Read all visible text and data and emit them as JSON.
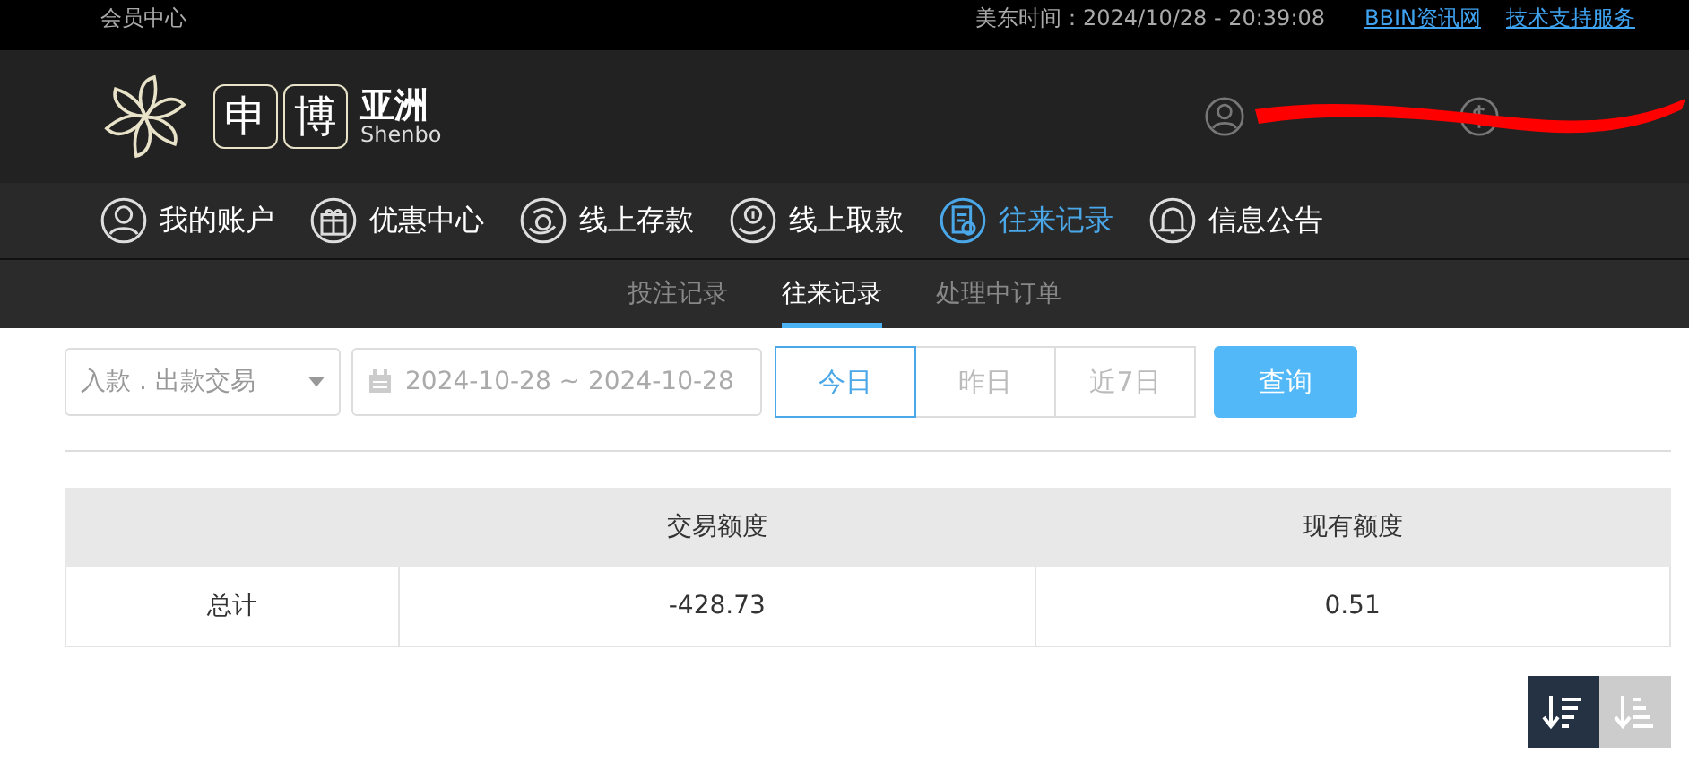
{
  "topbar": {
    "title": "会员中心",
    "time": "美东时间：2024/10/28 - 20:39:08",
    "links": [
      "BBIN资讯网",
      "技术支持服务"
    ]
  },
  "logo": {
    "chars": [
      "申",
      "博"
    ],
    "cn": "亚洲",
    "en": "Shenbo"
  },
  "nav": [
    {
      "label": "我的账户",
      "kind": "user",
      "selected": false
    },
    {
      "label": "优惠中心",
      "kind": "gift",
      "selected": false
    },
    {
      "label": "线上存款",
      "kind": "deposit",
      "selected": false
    },
    {
      "label": "线上取款",
      "kind": "withdraw",
      "selected": false
    },
    {
      "label": "往来记录",
      "kind": "record",
      "selected": true
    },
    {
      "label": "信息公告",
      "kind": "bell",
      "selected": false
    }
  ],
  "subnav": [
    {
      "label": "投注记录",
      "selected": false
    },
    {
      "label": "往来记录",
      "selected": true
    },
    {
      "label": "处理中订单",
      "selected": false
    }
  ],
  "filter": {
    "type": "入款 . 出款交易",
    "date_range": "2024-10-28 ~ 2024-10-28",
    "ranges": [
      {
        "label": "今日",
        "selected": true
      },
      {
        "label": "昨日",
        "selected": false
      },
      {
        "label": "近7日",
        "selected": false
      }
    ],
    "search": "查询"
  },
  "summary": {
    "columns": [
      "",
      "交易额度",
      "现有额度"
    ],
    "rows": [
      [
        "总计",
        "-428.73",
        "0.51"
      ]
    ]
  },
  "sort": [
    {
      "kind": "desc",
      "selected": true
    },
    {
      "kind": "asc",
      "selected": false
    }
  ]
}
